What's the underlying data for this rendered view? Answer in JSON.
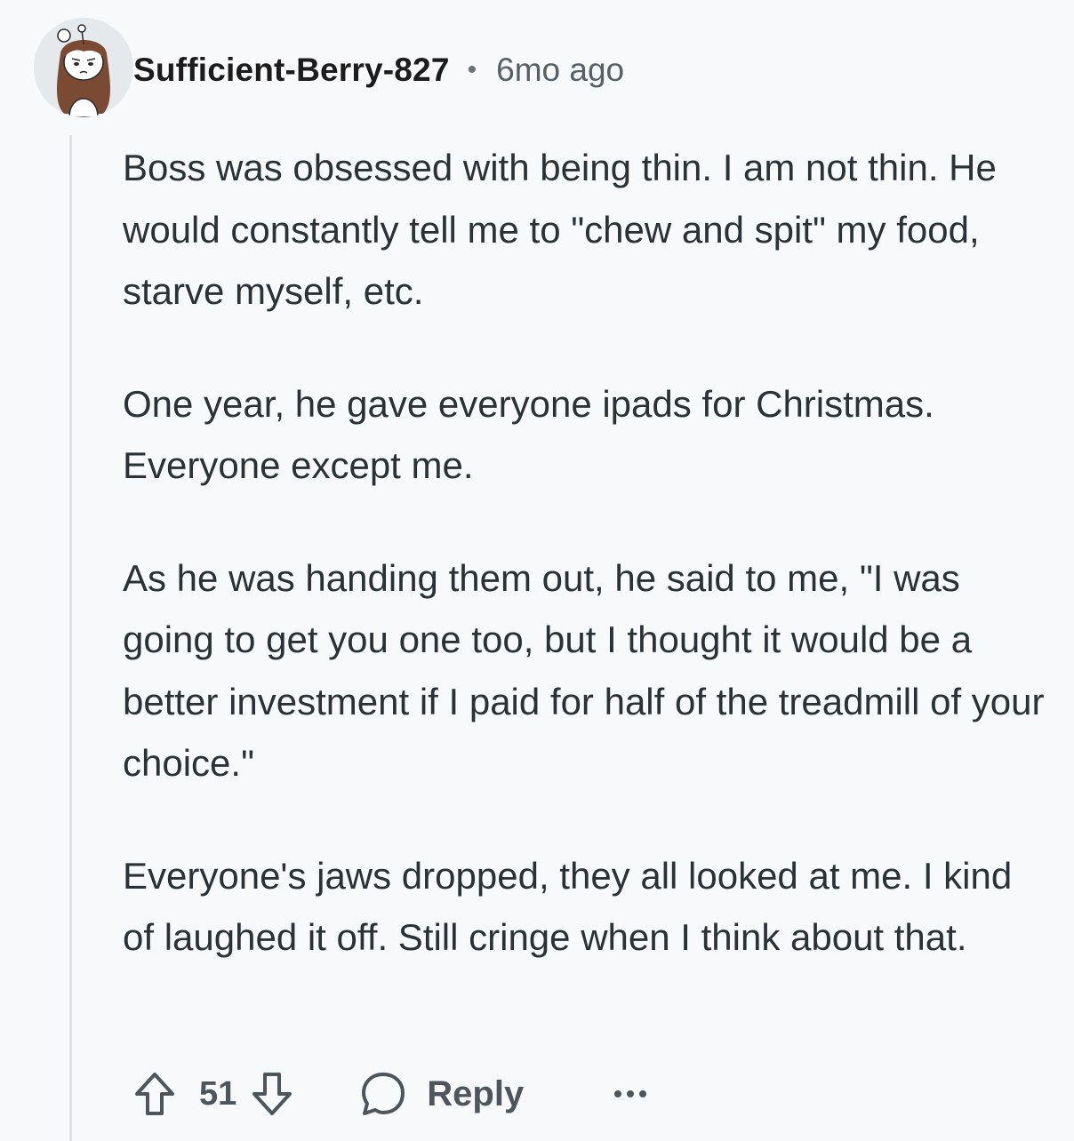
{
  "comment": {
    "author": "Sufficient-Berry-827",
    "separator": "•",
    "timestamp": "6mo ago",
    "paragraphs": [
      "Boss was obsessed with being thin. I am not thin. He would constantly tell me to \"chew and spit\" my food, starve myself, etc.",
      "One year, he gave everyone ipads for Christmas. Everyone except me.",
      "As he was handing them out, he said to me, \"I was going to get you one too, but I thought it would be a better investment if I paid for half of the treadmill of your choice.\"",
      "Everyone's jaws dropped, they all looked at me. I kind of laughed it off. Still cringe when I think about that."
    ]
  },
  "actions": {
    "upvote_icon": "arrow-up-icon",
    "score": "51",
    "downvote_icon": "arrow-down-icon",
    "reply_icon": "speech-bubble-icon",
    "reply_label": "Reply",
    "more_icon": "ellipsis-icon"
  },
  "colors": {
    "background": "#f8f9fb",
    "text": "#2a3236",
    "muted": "#576066",
    "thread_line": "#dfe3e7"
  }
}
